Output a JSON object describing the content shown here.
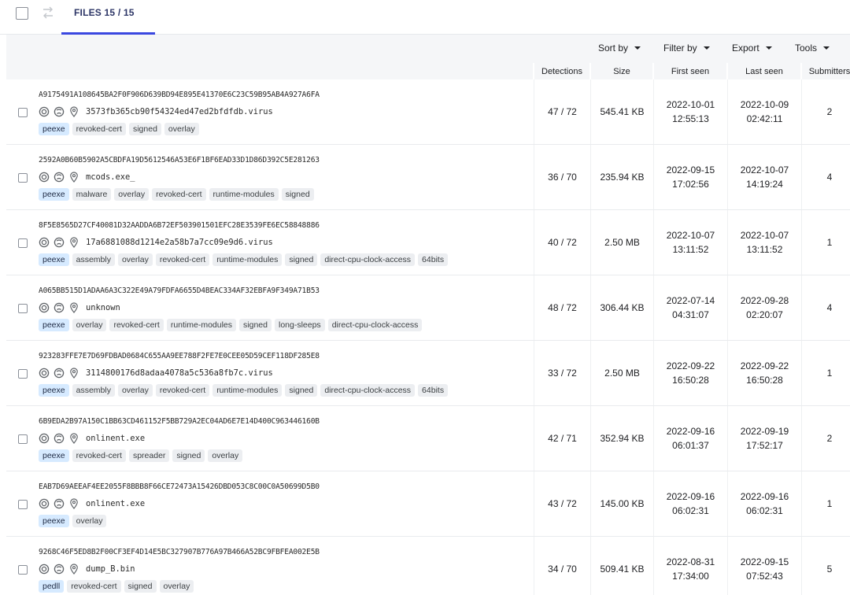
{
  "tabs": {
    "files_label": "FILES  15 / 15"
  },
  "toolbar": {
    "sort_by": "Sort by",
    "filter_by": "Filter by",
    "export": "Export",
    "tools": "Tools"
  },
  "columns": {
    "detections": "Detections",
    "size": "Size",
    "first_seen": "First seen",
    "last_seen": "Last seen",
    "submitters": "Submitters"
  },
  "rows": [
    {
      "hash": "A9175491A108645BA2F0F906D639BD94E895E41370E6C23C59B95AB4A927A6FA",
      "filename": "3573fb365cb90f54324ed47ed2bfdfdb.virus",
      "tags": [
        "peexe",
        "revoked-cert",
        "signed",
        "overlay"
      ],
      "detections": "47 / 72",
      "size": "545.41 KB",
      "first_seen_date": "2022-10-01",
      "first_seen_time": "12:55:13",
      "last_seen_date": "2022-10-09",
      "last_seen_time": "02:42:11",
      "submitters": "2"
    },
    {
      "hash": "2592A0B60B5902A5CBDFA19D5612546A53E6F1BF6EAD33D1D86D392C5E281263",
      "filename": "mcods.exe_",
      "tags": [
        "peexe",
        "malware",
        "overlay",
        "revoked-cert",
        "runtime-modules",
        "signed"
      ],
      "detections": "36 / 70",
      "size": "235.94 KB",
      "first_seen_date": "2022-09-15",
      "first_seen_time": "17:02:56",
      "last_seen_date": "2022-10-07",
      "last_seen_time": "14:19:24",
      "submitters": "4"
    },
    {
      "hash": "8F5E8565D27CF40081D32AADDA6B72EF503901501EFC28E3539FE6EC58848886",
      "filename": "17a6881088d1214e2a58b7a7cc09e9d6.virus",
      "tags": [
        "peexe",
        "assembly",
        "overlay",
        "revoked-cert",
        "runtime-modules",
        "signed",
        "direct-cpu-clock-access",
        "64bits"
      ],
      "detections": "40 / 72",
      "size": "2.50 MB",
      "first_seen_date": "2022-10-07",
      "first_seen_time": "13:11:52",
      "last_seen_date": "2022-10-07",
      "last_seen_time": "13:11:52",
      "submitters": "1"
    },
    {
      "hash": "A065BB515D1ADAA6A3C322E49A79FDFA6655D4BEAC334AF32EBFA9F349A71B53",
      "filename": "unknown",
      "tags": [
        "peexe",
        "overlay",
        "revoked-cert",
        "runtime-modules",
        "signed",
        "long-sleeps",
        "direct-cpu-clock-access"
      ],
      "detections": "48 / 72",
      "size": "306.44 KB",
      "first_seen_date": "2022-07-14",
      "first_seen_time": "04:31:07",
      "last_seen_date": "2022-09-28",
      "last_seen_time": "02:20:07",
      "submitters": "4"
    },
    {
      "hash": "923283FFE7E7D69FDBAD0684C655AA9EE788F2FE7E0CEE05D59CEF118DF285E8",
      "filename": "3114800176d8adaa4078a5c536a8fb7c.virus",
      "tags": [
        "peexe",
        "assembly",
        "overlay",
        "revoked-cert",
        "runtime-modules",
        "signed",
        "direct-cpu-clock-access",
        "64bits"
      ],
      "detections": "33 / 72",
      "size": "2.50 MB",
      "first_seen_date": "2022-09-22",
      "first_seen_time": "16:50:28",
      "last_seen_date": "2022-09-22",
      "last_seen_time": "16:50:28",
      "submitters": "1"
    },
    {
      "hash": "6B9EDA2B97A150C1BB63CD461152F5BB729A2EC04AD6E7E14D400C963446160B",
      "filename": "onlinent.exe",
      "tags": [
        "peexe",
        "revoked-cert",
        "spreader",
        "signed",
        "overlay"
      ],
      "detections": "42 / 71",
      "size": "352.94 KB",
      "first_seen_date": "2022-09-16",
      "first_seen_time": "06:01:37",
      "last_seen_date": "2022-09-19",
      "last_seen_time": "17:52:17",
      "submitters": "2"
    },
    {
      "hash": "EAB7D69AEEAF4EE2055F8BBB8F66CE72473A15426DBD053C8C00C0A50699D5B0",
      "filename": "onlinent.exe",
      "tags": [
        "peexe",
        "overlay"
      ],
      "detections": "43 / 72",
      "size": "145.00 KB",
      "first_seen_date": "2022-09-16",
      "first_seen_time": "06:02:31",
      "last_seen_date": "2022-09-16",
      "last_seen_time": "06:02:31",
      "submitters": "1"
    },
    {
      "hash": "9268C46F5ED8B2F00CF3EF4D14E5BC327907B776A97B466A52BC9FBFEA002E5B",
      "filename": "dump_B.bin",
      "tags": [
        "pedll",
        "revoked-cert",
        "signed",
        "overlay"
      ],
      "detections": "34 / 70",
      "size": "509.41 KB",
      "first_seen_date": "2022-08-31",
      "first_seen_time": "17:34:00",
      "last_seen_date": "2022-09-15",
      "last_seen_time": "07:52:43",
      "submitters": "5"
    }
  ]
}
